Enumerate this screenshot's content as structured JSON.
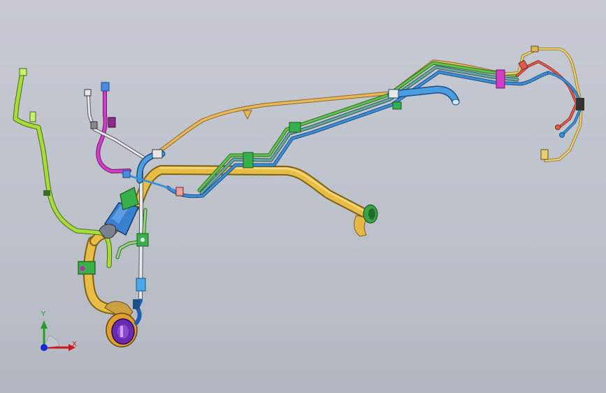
{
  "viewport": {
    "background_top": "#c7cad3",
    "background_bottom": "#b4b8c1"
  },
  "triad": {
    "x_label": "X",
    "y_label": "Y",
    "x_color": "#d01818",
    "y_color": "#22a022",
    "z_color": "#1a2ad0"
  },
  "colors": {
    "main_duct": "#e8bd45",
    "main_duct_shade": "#b08a22",
    "fuel_line_yellow": "#e8b85a",
    "line_green": "#62c24a",
    "line_lime": "#a6dd3a",
    "line_teal": "#6aa8a0",
    "line_blue": "#3b8fd6",
    "line_magenta": "#d23cc8",
    "line_white": "#e8e8ec",
    "line_red": "#e05a4a",
    "clip_green": "#36b04a",
    "canister_blue": "#3a7fd0",
    "pump_purple": "#6a2ab0",
    "pump_ring": "#e0a030"
  }
}
